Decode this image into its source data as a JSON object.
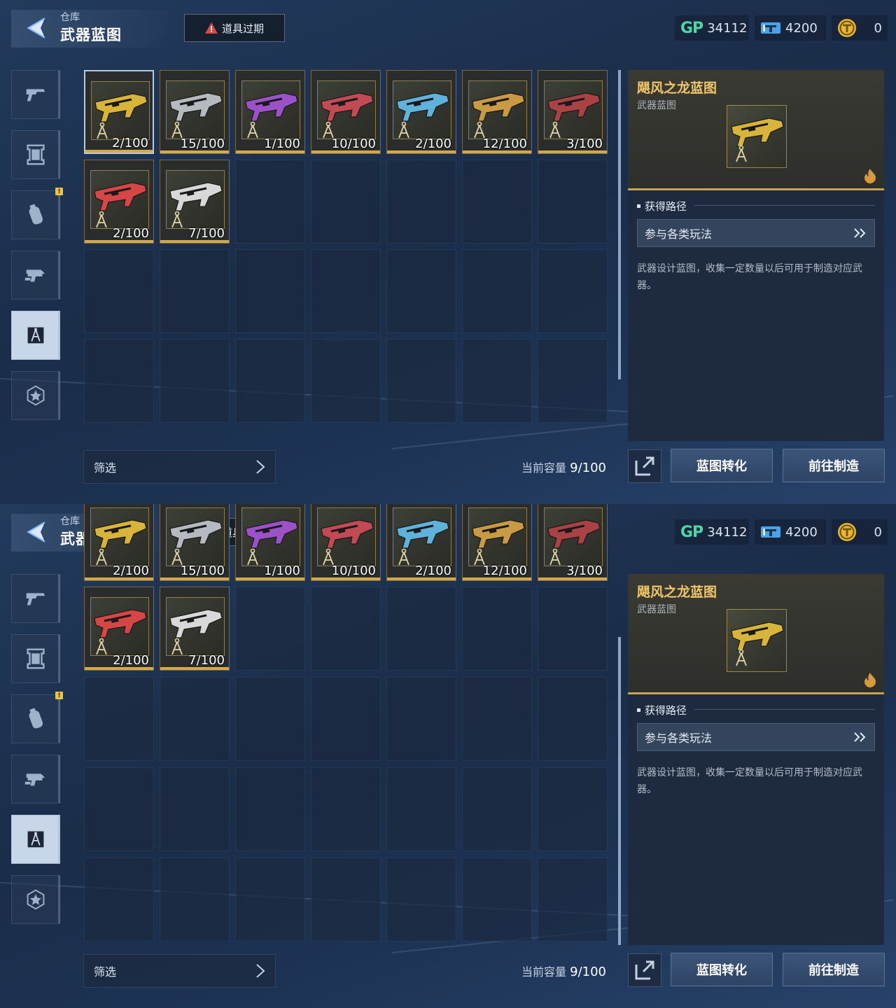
{
  "header": {
    "crumb": "仓库",
    "title": "武器蓝图",
    "expire_label": "道具过期"
  },
  "currencies": {
    "gp_label": "GP",
    "gp": "34112",
    "ticket": "4200",
    "coin": "0"
  },
  "nav": {
    "items": [
      {
        "name": "nav-pistol",
        "icon": "pistol-icon"
      },
      {
        "name": "nav-frame",
        "icon": "frame-icon"
      },
      {
        "name": "nav-grenade",
        "icon": "grenade-icon"
      },
      {
        "name": "nav-weapon-part",
        "icon": "weapon-part-icon"
      },
      {
        "name": "nav-blueprint",
        "icon": "blueprint-compass-icon",
        "active": true
      },
      {
        "name": "nav-star",
        "icon": "star-badge-icon"
      }
    ],
    "badge": "!"
  },
  "items": [
    {
      "count": "2/100",
      "color": "#d8b53a"
    },
    {
      "count": "15/100",
      "color": "#b5b9c0"
    },
    {
      "count": "1/100",
      "color": "#9b52c9"
    },
    {
      "count": "10/100",
      "color": "#c24a55"
    },
    {
      "count": "2/100",
      "color": "#5fb2d9"
    },
    {
      "count": "12/100",
      "color": "#c89a43"
    },
    {
      "count": "3/100",
      "color": "#a84244"
    },
    {
      "count": "2/100",
      "color": "#d64646"
    },
    {
      "count": "7/100",
      "color": "#d8d8d8"
    }
  ],
  "filter": {
    "label": "筛选"
  },
  "capacity": {
    "label": "当前容量",
    "value": "9/100"
  },
  "detail": {
    "name": "飓风之龙蓝图",
    "type": "武器蓝图",
    "section": "获得路径",
    "route": "参与各类玩法",
    "description": "武器设计蓝图，收集一定数量以后可用于制造对应武器。"
  },
  "buttons": {
    "convert": "蓝图转化",
    "craft": "前往制造"
  },
  "colors": {
    "accent_gold": "#d4a94a",
    "gp_green": "#4fd6a6",
    "badge_yellow": "#f0c330"
  }
}
